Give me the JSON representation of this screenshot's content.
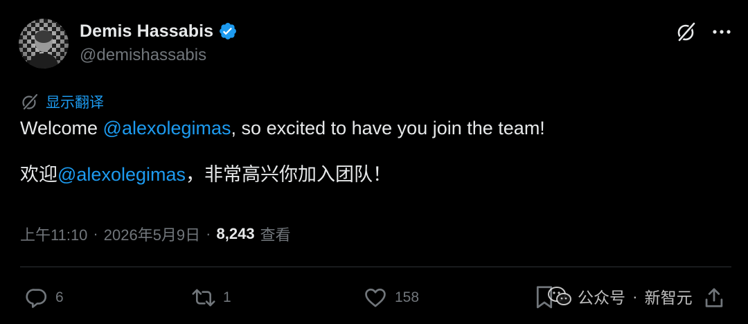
{
  "author": {
    "display_name": "Demis Hassabis",
    "handle": "@demishassabis",
    "verified_icon": "verified-badge-icon",
    "verified_color": "#1d9bf0"
  },
  "header_actions": {
    "grok_icon": "grok-icon",
    "more_icon": "more-horizontal-icon"
  },
  "translate": {
    "label": "显示翻译",
    "icon": "translate-globe-icon"
  },
  "tweet": {
    "en": {
      "prefix": "Welcome ",
      "mention": "@alexolegimas",
      "suffix": ", so excited to have you join the team!"
    },
    "zh": {
      "prefix": "欢迎",
      "mention": "@alexolegimas",
      "suffix": "，非常高兴你加入团队！"
    }
  },
  "meta": {
    "time": "上午11:10",
    "dot1": "·",
    "date": "2026年5月9日",
    "dot2": "·",
    "views": "8,243",
    "views_label": "查看"
  },
  "actions": {
    "replies": "6",
    "reposts": "1",
    "likes": "158"
  },
  "watermark": {
    "source": "公众号",
    "dot": "·",
    "name": "新智元"
  },
  "colors": {
    "background": "#000000",
    "text": "#e7e9ea",
    "secondary": "#71767b",
    "link": "#1d9bf0",
    "divider": "#2f3336"
  }
}
